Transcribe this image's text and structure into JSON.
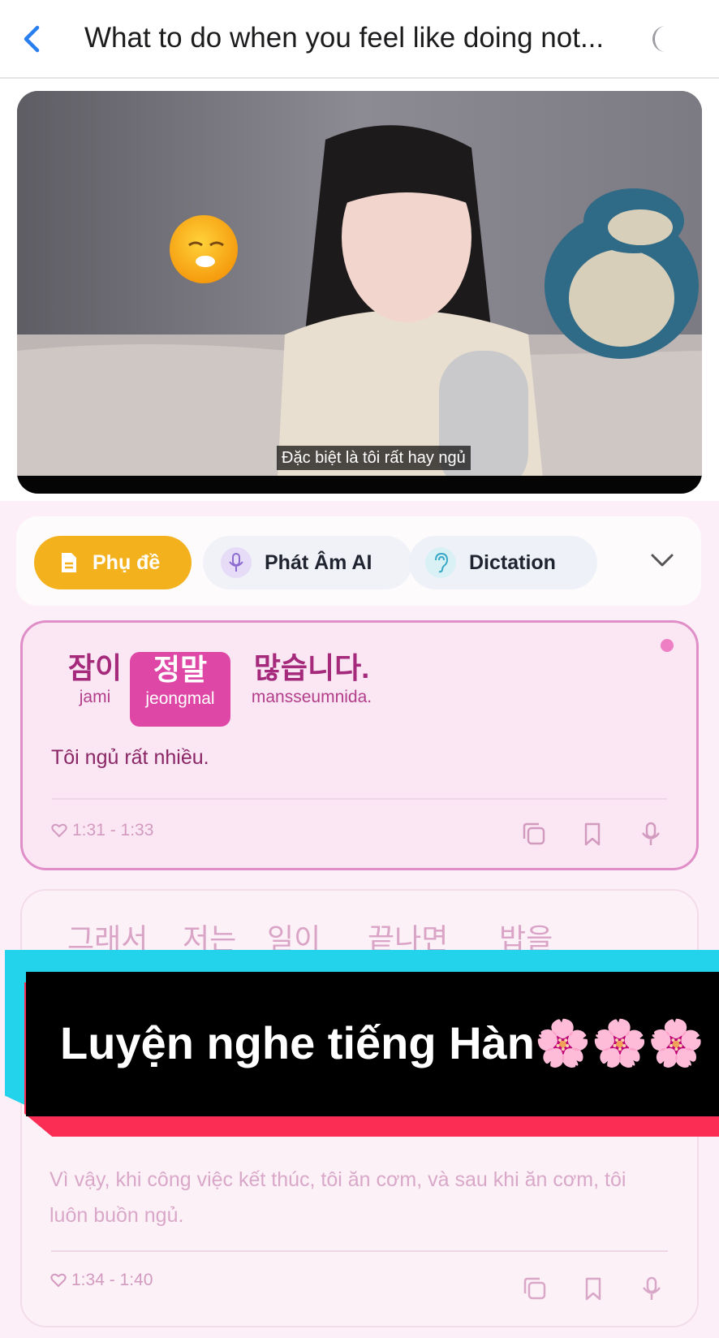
{
  "header": {
    "title": "What to do when you feel like doing not...",
    "back_icon": "chevron-left-icon",
    "moon_icon": "moon-icon"
  },
  "video": {
    "subtitle": "Đặc biệt là tôi rất hay ngủ"
  },
  "tabs": [
    {
      "label": "Phụ đề",
      "icon": "document-icon"
    },
    {
      "label": "Phát Âm AI",
      "icon": "microphone-icon"
    },
    {
      "label": "Dictation",
      "icon": "ear-icon"
    }
  ],
  "card1": {
    "words": [
      {
        "korean": "잠이",
        "roman": "jami"
      },
      {
        "korean": "정말",
        "roman": "jeongmal"
      },
      {
        "korean": "많습니다.",
        "roman": "mansseumnida."
      }
    ],
    "translation": "Tôi ngủ rất nhiều.",
    "time": "1:31 - 1:33"
  },
  "card2": {
    "words": [
      "그래서",
      "저는",
      "일이",
      "끝나면",
      "밥을"
    ],
    "translation": "Vì vậy, khi công việc kết thúc, tôi ăn cơm, và sau khi ăn cơm, tôi luôn buồn ngủ.",
    "time": "1:34 - 1:40"
  },
  "banner": {
    "text": "Luyện nghe tiếng Hàn🌸🌸🌸"
  },
  "colors": {
    "accent_pink": "#de47a6",
    "phu_de_yellow": "#f3b21d",
    "back_blue": "#2a7ff0",
    "banner_cyan": "#22d3eb",
    "banner_red": "#fb2d55"
  }
}
